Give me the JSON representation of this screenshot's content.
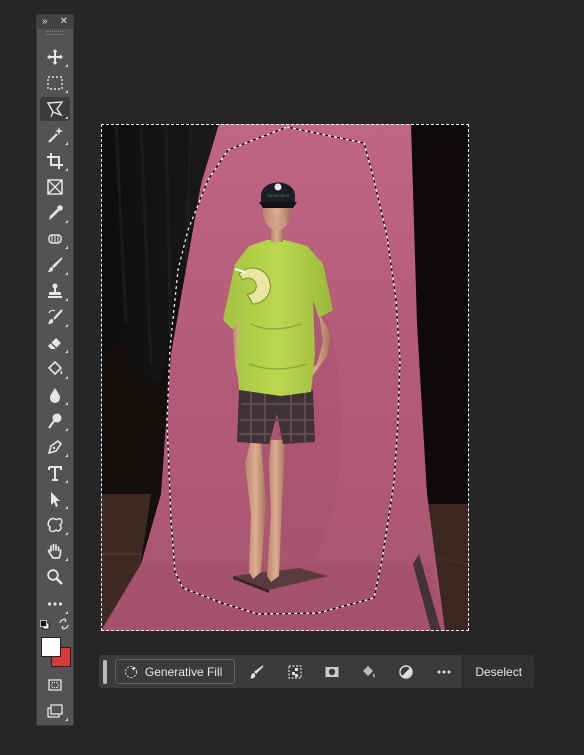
{
  "toolbar": {
    "icons": [
      "move-icon",
      "marquee-icon",
      "polygonal-lasso-icon",
      "magic-wand-icon",
      "crop-icon",
      "frame-icon",
      "eyedropper-icon",
      "spot-healing-icon",
      "brush-icon",
      "clone-stamp-icon",
      "history-brush-icon",
      "eraser-icon",
      "paint-bucket-icon",
      "blur-icon",
      "dodge-icon",
      "pen-icon",
      "type-icon",
      "path-selection-icon",
      "shape-icon",
      "hand-icon",
      "zoom-icon",
      "more-tools-icon",
      "quick-mask-icon",
      "screen-mode-icon"
    ],
    "active_tool": "polygonal-lasso-icon",
    "foreground_color": "#ffffff",
    "background_color": "#d83a3a"
  },
  "canvas": {
    "backdrop_color": "#b45a78",
    "shirt_color": "#b4d24a",
    "cap_logo": "Generative"
  },
  "taskbar": {
    "generative_fill_label": "Generative Fill",
    "deselect_label": "Deselect",
    "buttons": [
      "modify-selection-icon",
      "select-subject-icon",
      "mask-icon",
      "fill-icon",
      "adjustment-icon",
      "more-options-icon"
    ]
  }
}
